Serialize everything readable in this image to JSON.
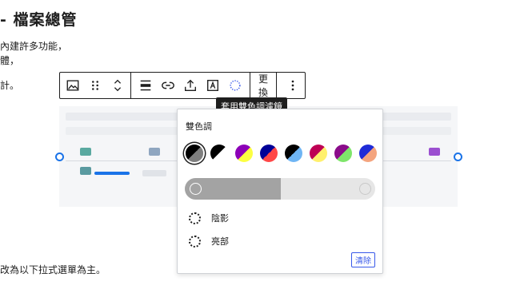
{
  "page": {
    "heading": "- 檔案總管",
    "lines": [
      "內建許多功能，",
      "體，",
      "計。",
      "改為以下拉式選單為主。"
    ]
  },
  "toolbar": {
    "image_icon": "image-icon",
    "drag_icon": "drag-handle-icon",
    "move_icon": "chevron-up-down-icon",
    "align_icon": "align-icon",
    "link_icon": "link-icon",
    "upload_icon": "upload-icon",
    "text_icon": "text-overlay-icon",
    "duotone_icon": "duotone-icon",
    "replace_label": "更換",
    "more_icon": "more-vertical-icon"
  },
  "tooltip": "套用雙色調濾鏡",
  "duotone": {
    "title": "雙色調",
    "swatches": [
      {
        "a": "#000000",
        "b": "#7f7f7f",
        "selected": true
      },
      {
        "a": "#000000",
        "b": "#ffffff",
        "selected": false
      },
      {
        "a": "#8c00b7",
        "b": "#fcff41",
        "selected": false
      },
      {
        "a": "#000097",
        "b": "#ff4747",
        "selected": false
      },
      {
        "a": "#000000",
        "b": "#6fb5f4",
        "selected": false
      },
      {
        "a": "#be0054",
        "b": "#fff06d",
        "selected": false
      },
      {
        "a": "#8a0c8a",
        "b": "#7ee56a",
        "selected": false
      },
      {
        "a": "#1f2bd7",
        "b": "#f4a47e",
        "selected": false
      }
    ],
    "shadow_label": "陰影",
    "highlight_label": "亮部",
    "clear_label": "清除",
    "shadow_color": "#a3a3a3",
    "highlight_color": "#e6e6e6"
  }
}
